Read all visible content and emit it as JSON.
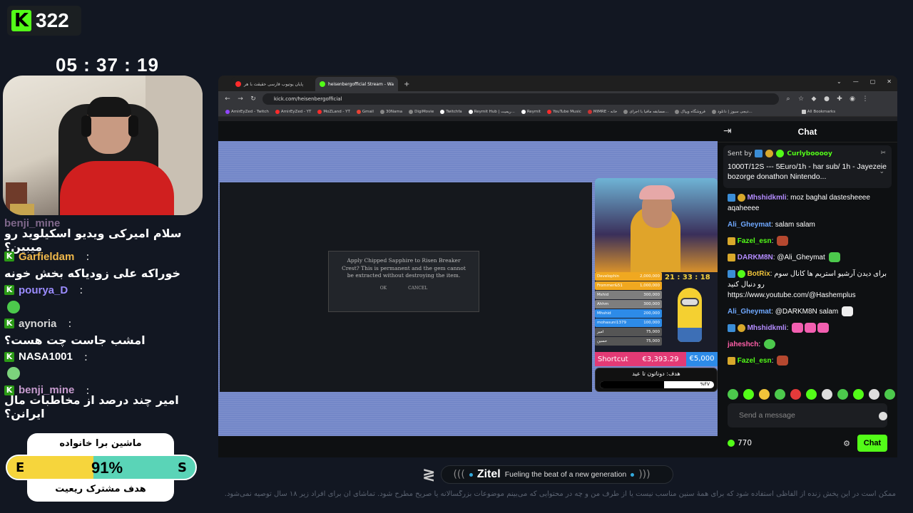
{
  "overlay": {
    "viewer_count": "322",
    "timer": "05 : 37 : 19",
    "chat": [
      {
        "user": "benji_mine",
        "color": "#c79ccf",
        "message": "سلام امیرکی ویدیو اسکیلوید رو میبین؟"
      },
      {
        "user": "Garfieldam",
        "color": "#f0b84a",
        "message": "خوراکه علی زودیاکه بخش خونه"
      },
      {
        "user": "pourya_D",
        "color": "#9b8cff",
        "message": ""
      },
      {
        "user": "aynoria",
        "color": "#d6d6d6",
        "message": "امشب جاست چت هست؟"
      },
      {
        "user": "NASA1001",
        "color": "#ffffff",
        "message": ""
      },
      {
        "user": "benji_mine",
        "color": "#c79ccf",
        "message": "امیر چند درصد از مخاطبات مال ایرانن؟"
      }
    ],
    "goal_top": "ماشین برا خانواده",
    "goal_left": "E",
    "goal_right": "S",
    "goal_percent": "91%",
    "goal_fill": 0.46,
    "goal_bottom": "هدف مشترک ریعیت"
  },
  "browser": {
    "tabs": [
      {
        "label": "پایان یوتیوب فارسی حقیقت با هر",
        "active": false,
        "icon_color": "#ff2b2b"
      },
      {
        "label": "heisenbergofficial Stream - Wa",
        "active": true,
        "icon_color": "#53fc18"
      }
    ],
    "new_tab": "+",
    "url": "kick.com/heisenbergofficial",
    "bookmarks": [
      "AmirEyZed - Twitch",
      "AmirEyZed - YT",
      "MoZLand - YT",
      "Gmail",
      "30Nama",
      "DigiMovie",
      "Twitchfa",
      "Reymit Hub | ریمیت...",
      "Reymit",
      "YouTube Music",
      "MIMRE - خانه",
      "مسابقه مافیا با اجرای...",
      "فروشگاه ویپاک",
      "دیجی سیوز | دانلود...",
      "All Bookmarks"
    ]
  },
  "game": {
    "dialog_text": "Apply Chipped Sapphire to Risen Breaker Crest? This is permanent and the gem cannot be extracted without destroying the item.",
    "ok": "OK",
    "cancel": "CANCEL"
  },
  "stream_overlay": {
    "timer": "21 : 33 : 18",
    "leaderboard": [
      {
        "name": "Develophin",
        "value": "2,000,000",
        "color": "#f0a820"
      },
      {
        "name": "Frommer&51",
        "value": "1,000,000",
        "color": "#f0a820"
      },
      {
        "name": "Mshid",
        "value": "300,000",
        "color": "#7e7e7e"
      },
      {
        "name": "Ahhm",
        "value": "300,000",
        "color": "#7e7e7e"
      },
      {
        "name": "Mhshid",
        "value": "200,000",
        "color": "#2d8be8"
      },
      {
        "name": "mohasuni1379",
        "value": "100,000",
        "color": "#2d8be8"
      },
      {
        "name": "امیر",
        "value": "75,000",
        "color": "#555"
      },
      {
        "name": "حسین",
        "value": "75,000",
        "color": "#555"
      }
    ],
    "shortcut_label": "Shortcut",
    "shortcut_value": "€3,393.29",
    "shortcut_goal": "€5,000",
    "donate_title": "هدف: دوناتون تا عید",
    "donate_percent": "%FV",
    "donate_fill": 0.56
  },
  "chat_panel": {
    "title": "Chat",
    "pinned_by_label": "Sent by",
    "pinned_user": "Curlybooooy",
    "pinned_text": "1000T/12S --- 5Euro/1h - har sub/ 1h - Jayezeie bozorge donathon Nintendo...",
    "messages": [
      {
        "user": "Mhshidkmli",
        "color": "#b48cff",
        "text": "moz baghal dastesheeee aqaheeee"
      },
      {
        "user": "Ali_Gheymat",
        "color": "#6fa8ff",
        "text": "salam salam"
      },
      {
        "user": "Fazel_esn",
        "color": "#53fc18",
        "text": ""
      },
      {
        "user": "DARKM8N",
        "color": "#b48cff",
        "text": "@Ali_Gheymat"
      },
      {
        "user": "BotRix",
        "color": "#f0c43a",
        "text": "برای دیدن آرشیو استریم ها کانال سوم رو دنبال کنید https://www.youtube.com/@Hashemplus"
      },
      {
        "user": "Ali_Gheymat",
        "color": "#6fa8ff",
        "text": "@DARKM8N salam"
      },
      {
        "user": "Mhshidkmli",
        "color": "#b48cff",
        "text": ""
      },
      {
        "user": "jaheshch",
        "color": "#ff5fa8",
        "text": ""
      },
      {
        "user": "Fazel_esn",
        "color": "#53fc18",
        "text": ""
      }
    ],
    "input_placeholder": "Send a message",
    "points": "770",
    "chat_button": "Chat"
  },
  "banner": {
    "brand": "Zitel",
    "tagline": "Fueling the beat of a new generation",
    "disclaimer": "ممکن است در این پخش زنده از الفاظی استفاده شود که برای همهٔ سنین مناسب نیست یا از طرف من و چه در محتوایی که می‌بینم موضوعات بزرگسالانه یا صریح مطرح شود. تماشای آن برای افراد زیر ۱۸ سال توصیه نمی‌شود."
  }
}
